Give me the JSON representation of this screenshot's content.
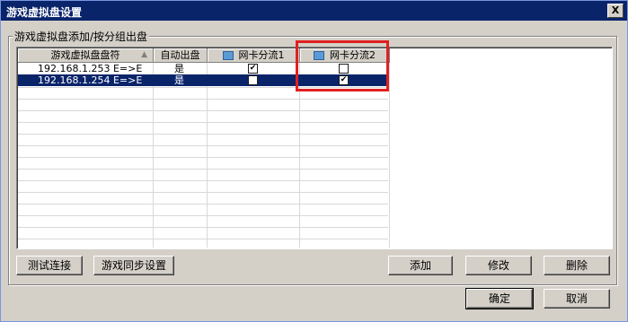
{
  "window": {
    "title": "游戏虚拟盘设置",
    "close_label": "X"
  },
  "group": {
    "label": "游戏虚拟盘添加/按分组出盘"
  },
  "table": {
    "columns": [
      "游戏虚拟盘盘符",
      "自动出盘",
      "网卡分流1",
      "网卡分流2"
    ],
    "sort_indicator": "▲",
    "rows": [
      {
        "name": "192.168.1.253 E=>E",
        "auto": "是",
        "nic1": "✔",
        "nic2": "",
        "selected": false
      },
      {
        "name": "192.168.1.254 E=>E",
        "auto": "是",
        "nic1": "",
        "nic2": "✔",
        "selected": true
      }
    ]
  },
  "buttons": {
    "test_connect": "测试连接",
    "game_sync": "游戏同步设置",
    "add": "添加",
    "modify": "修改",
    "delete": "删除",
    "ok": "确定",
    "cancel": "取消"
  },
  "colors": {
    "selection": "#0a246a",
    "highlight_box": "#e02020",
    "titlebar": "#0a246a"
  },
  "icons": {
    "column_icon": "network-card-icon"
  }
}
